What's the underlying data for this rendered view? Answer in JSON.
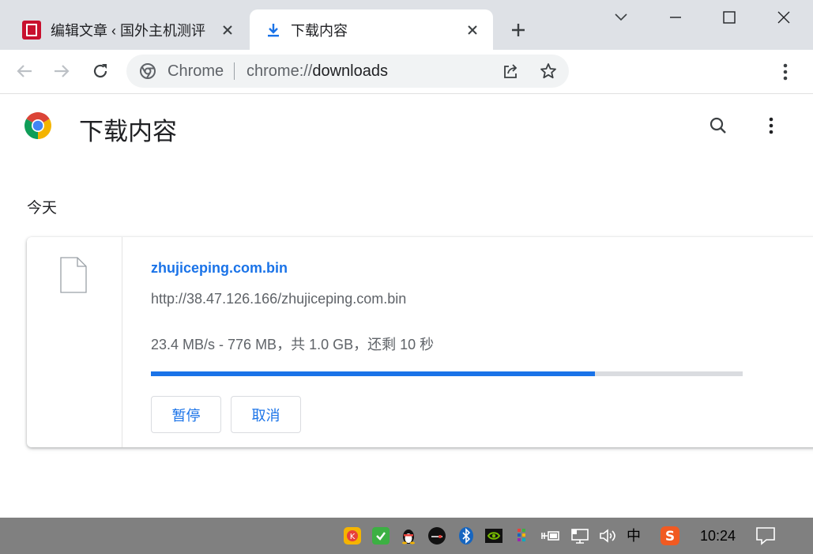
{
  "tabs": [
    {
      "title": "编辑文章 ‹ 国外主机测评",
      "active": false
    },
    {
      "title": "下载内容",
      "active": true
    }
  ],
  "omnibox": {
    "site_label": "Chrome",
    "url_scheme": "chrome://",
    "url_host": "downloads"
  },
  "page": {
    "title": "下载内容",
    "section_date": "今天"
  },
  "download": {
    "file_name": "zhujiceping.com.bin",
    "url": "http://38.47.126.166/zhujiceping.com.bin",
    "status": "23.4 MB/s - 776 MB，共 1.0 GB，还剩 10 秒",
    "progress_fraction": 0.75,
    "pause_label": "暂停",
    "cancel_label": "取消"
  },
  "taskbar": {
    "ime_label": "中",
    "clock": "10:24"
  },
  "colors": {
    "accent": "#1a73e8",
    "tabstrip": "#dee1e6",
    "taskbar": "#808080"
  }
}
